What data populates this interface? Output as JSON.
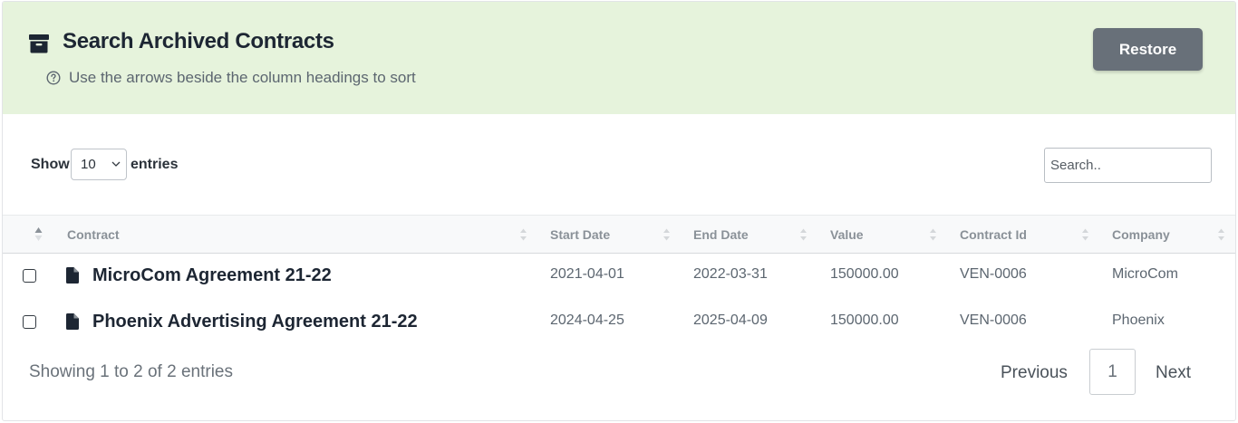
{
  "header": {
    "title": "Search Archived Contracts",
    "help_text": "Use the arrows beside the column headings to sort",
    "restore_label": "Restore",
    "background_color": "#e6f3dc",
    "title_icon": "archive-box-icon",
    "help_icon": "question-circle-icon"
  },
  "controls": {
    "show_label": "Show",
    "entries_value": "10",
    "entries_label": "entries",
    "search_placeholder": "Search.."
  },
  "table": {
    "columns": [
      "Contract",
      "Start Date",
      "End Date",
      "Value",
      "Contract Id",
      "Company"
    ],
    "rows": [
      {
        "contract": "MicroCom Agreement 21-22",
        "start_date": "2021-04-01",
        "end_date": "2022-03-31",
        "value": "150000.00",
        "contract_id": "VEN-0006",
        "company": "MicroCom"
      },
      {
        "contract": "Phoenix Advertising Agreement 21-22",
        "start_date": "2024-04-25",
        "end_date": "2025-04-09",
        "value": "150000.00",
        "contract_id": "VEN-0006",
        "company": "Phoenix"
      }
    ]
  },
  "footer": {
    "showing_text": "Showing 1 to 2 of 2 entries",
    "previous_label": "Previous",
    "current_page": "1",
    "next_label": "Next"
  }
}
